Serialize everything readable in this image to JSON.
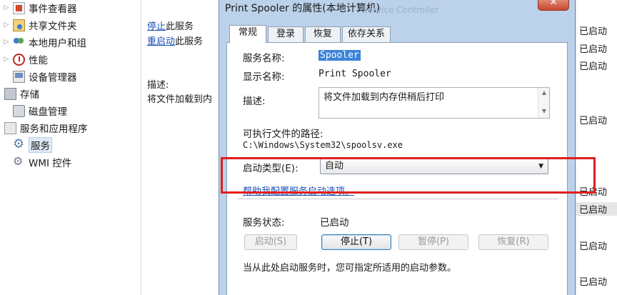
{
  "tree": {
    "items": [
      {
        "label": "事件查看器",
        "expander": "▷"
      },
      {
        "label": "共享文件夹",
        "expander": "▷"
      },
      {
        "label": "本地用户和组",
        "expander": "▷"
      },
      {
        "label": "性能",
        "expander": "▷"
      },
      {
        "label": "设备管理器",
        "expander": ""
      },
      {
        "label": "存储",
        "expander": ""
      },
      {
        "label": "磁盘管理",
        "expander": ""
      },
      {
        "label": "服务和应用程序",
        "expander": ""
      },
      {
        "label": "服务",
        "expander": ""
      },
      {
        "label": "WMI 控件",
        "expander": ""
      }
    ]
  },
  "middle": {
    "stop_link": "停止",
    "stop_text": "此服务",
    "restart_link": "重启动",
    "restart_text": "此服务",
    "desc_label": "描述:",
    "desc_text": "将文件加载到内"
  },
  "status_column": [
    "已启动",
    "已启动",
    "已启动",
    "已启动",
    "已启动",
    "已启动",
    "已启动",
    "已启动"
  ],
  "dialog": {
    "title": "Print Spooler 的属性(本地计算机)",
    "ghost_title": "Service Controller",
    "close_label": "✕",
    "tabs": [
      "常规",
      "登录",
      "恢复",
      "依存关系"
    ],
    "service_name_label": "服务名称:",
    "service_name_value": "Spooler",
    "display_name_label": "显示名称:",
    "display_name_value": "Print Spooler",
    "description_label": "描述:",
    "description_value": "将文件加载到内存供稍后打印",
    "exe_path_label": "可执行文件的路径:",
    "exe_path_value": "C:\\Windows\\System32\\spoolsv.exe",
    "startup_type_label": "启动类型(E):",
    "startup_type_value": "自动",
    "help_link": "帮助我配置服务启动选项。",
    "service_status_label": "服务状态:",
    "service_status_value": "已启动",
    "buttons": {
      "start": "启动(S)",
      "stop": "停止(T)",
      "pause": "暂停(P)",
      "resume": "恢复(R)"
    },
    "start_params_hint": "当从此处启动服务时，您可指定所适用的启动参数。"
  },
  "colors": {
    "annotation": "#e01e1e",
    "link": "#1a4fb5",
    "selection": "#3a83d8",
    "dialog_frame": "#bcd2ea"
  }
}
